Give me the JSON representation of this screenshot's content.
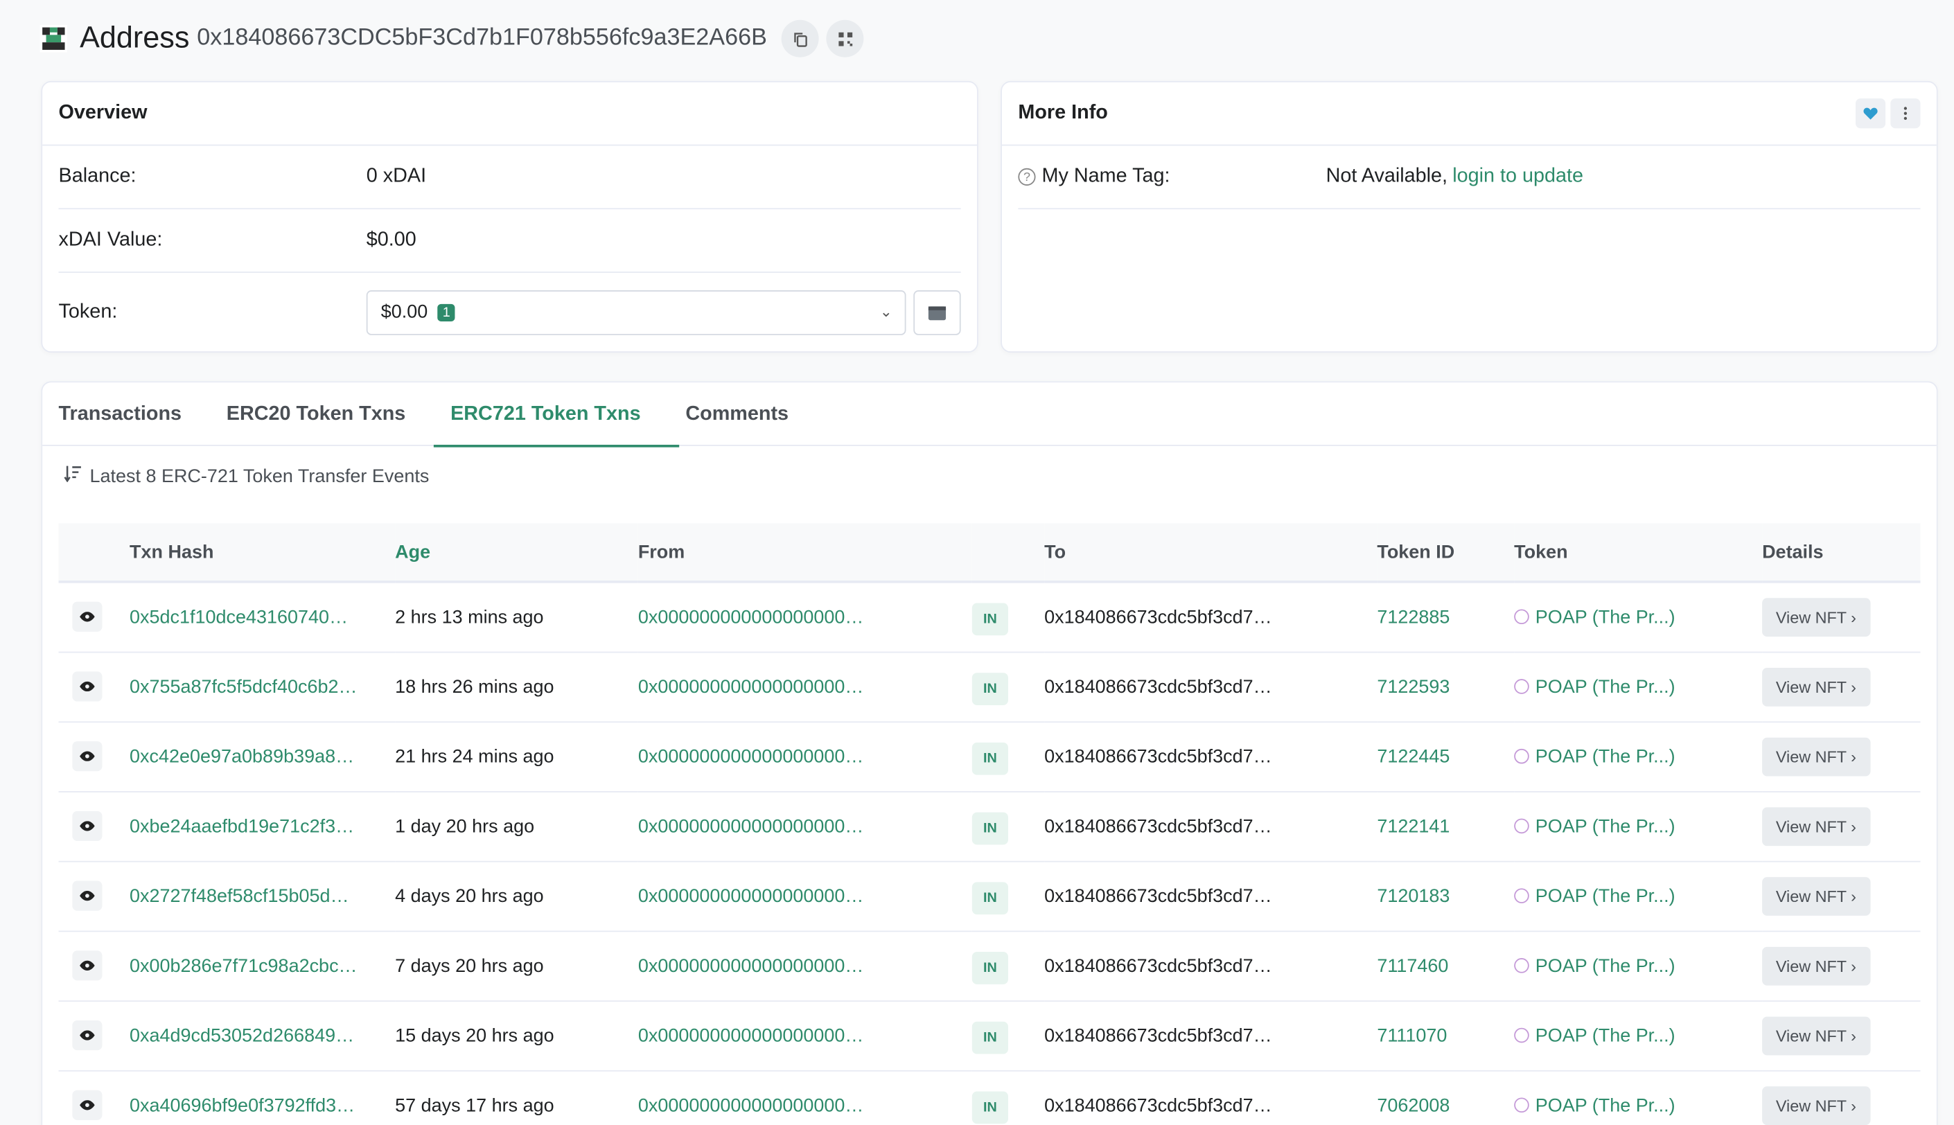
{
  "header": {
    "title": "Address",
    "address": "0x184086673CDC5bF3Cd7b1F078b556fc9a3E2A66B"
  },
  "overview": {
    "title": "Overview",
    "balance_label": "Balance:",
    "balance_value": "0 xDAI",
    "value_label": "xDAI Value:",
    "value_value": "$0.00",
    "token_label": "Token:",
    "token_value": "$0.00",
    "token_count": "1"
  },
  "more_info": {
    "title": "More Info",
    "name_tag_label": "My Name Tag:",
    "name_tag_value": "Not Available,",
    "name_tag_link": "login to update"
  },
  "tabs": [
    "Transactions",
    "ERC20 Token Txns",
    "ERC721 Token Txns",
    "Comments"
  ],
  "latest_text": "Latest 8 ERC-721 Token Transfer Events",
  "table": {
    "headers": [
      "Txn Hash",
      "Age",
      "From",
      "To",
      "Token ID",
      "Token",
      "Details"
    ],
    "rows": [
      {
        "hash": "0x5dc1f10dce43160740…",
        "age": "2 hrs 13 mins ago",
        "from": "0x000000000000000000…",
        "dir": "IN",
        "to": "0x184086673cdc5bf3cd7…",
        "token_id": "7122885",
        "token": "POAP (The Pr...)",
        "details": "View NFT"
      },
      {
        "hash": "0x755a87fc5f5dcf40c6b2…",
        "age": "18 hrs 26 mins ago",
        "from": "0x000000000000000000…",
        "dir": "IN",
        "to": "0x184086673cdc5bf3cd7…",
        "token_id": "7122593",
        "token": "POAP (The Pr...)",
        "details": "View NFT"
      },
      {
        "hash": "0xc42e0e97a0b89b39a8…",
        "age": "21 hrs 24 mins ago",
        "from": "0x000000000000000000…",
        "dir": "IN",
        "to": "0x184086673cdc5bf3cd7…",
        "token_id": "7122445",
        "token": "POAP (The Pr...)",
        "details": "View NFT"
      },
      {
        "hash": "0xbe24aaefbd19e71c2f3…",
        "age": "1 day 20 hrs ago",
        "from": "0x000000000000000000…",
        "dir": "IN",
        "to": "0x184086673cdc5bf3cd7…",
        "token_id": "7122141",
        "token": "POAP (The Pr...)",
        "details": "View NFT"
      },
      {
        "hash": "0x2727f48ef58cf15b05d…",
        "age": "4 days 20 hrs ago",
        "from": "0x000000000000000000…",
        "dir": "IN",
        "to": "0x184086673cdc5bf3cd7…",
        "token_id": "7120183",
        "token": "POAP (The Pr...)",
        "details": "View NFT"
      },
      {
        "hash": "0x00b286e7f71c98a2cbc…",
        "age": "7 days 20 hrs ago",
        "from": "0x000000000000000000…",
        "dir": "IN",
        "to": "0x184086673cdc5bf3cd7…",
        "token_id": "7117460",
        "token": "POAP (The Pr...)",
        "details": "View NFT"
      },
      {
        "hash": "0xa4d9cd53052d266849…",
        "age": "15 days 20 hrs ago",
        "from": "0x000000000000000000…",
        "dir": "IN",
        "to": "0x184086673cdc5bf3cd7…",
        "token_id": "7111070",
        "token": "POAP (The Pr...)",
        "details": "View NFT"
      },
      {
        "hash": "0xa40696bf9e0f3792ffd3…",
        "age": "57 days 17 hrs ago",
        "from": "0x000000000000000000…",
        "dir": "IN",
        "to": "0x184086673cdc5bf3cd7…",
        "token_id": "7062008",
        "token": "POAP (The Pr...)",
        "details": "View NFT"
      }
    ]
  },
  "colors": {
    "accent": "#2e8b6b",
    "border": "#e7eaf3"
  }
}
